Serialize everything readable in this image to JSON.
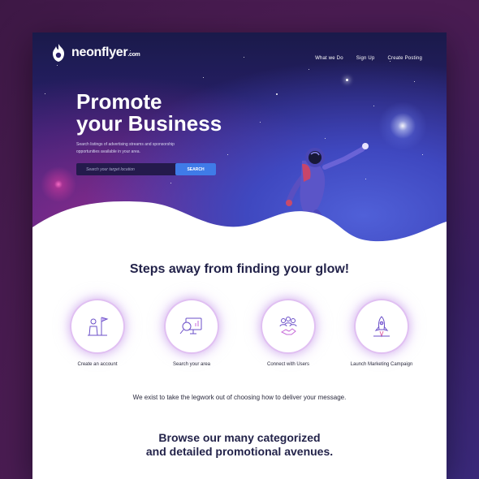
{
  "brand": {
    "name": "neonflyer",
    "suffix": ".com"
  },
  "nav": {
    "items": [
      "What we Do",
      "Sign Up",
      "Create Posting"
    ]
  },
  "hero": {
    "headline_line1": "Promote",
    "headline_line2": "your Business",
    "subtext": "Search listings of advertising streams and sponsorship opportunities available in your area.",
    "search_placeholder": "Search your target location",
    "search_button": "SEARCH"
  },
  "steps_section": {
    "title": "Steps away from finding your glow!",
    "steps": [
      {
        "label": "Create an account",
        "icon": "person-flag-icon"
      },
      {
        "label": "Search your area",
        "icon": "magnify-chart-icon"
      },
      {
        "label": "Connect with Users",
        "icon": "group-handshake-icon"
      },
      {
        "label": "Launch Marketing Campaign",
        "icon": "rocket-icon"
      }
    ]
  },
  "mission": "We exist to take the legwork out of choosing how to deliver your message.",
  "browse": {
    "line1": "Browse our many categorized",
    "line2": "and detailed promotional avenues."
  },
  "colors": {
    "accent": "#3f7be8",
    "brand_purple": "#8a4fd8",
    "dark_text": "#23234a"
  }
}
